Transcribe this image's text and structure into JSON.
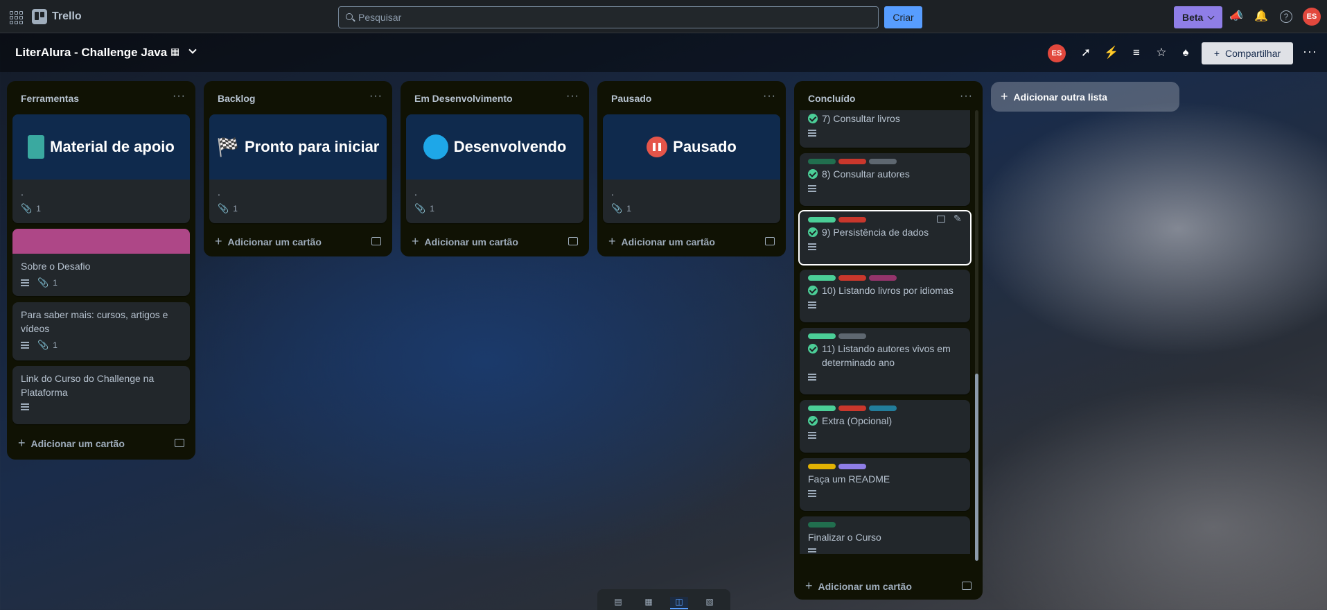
{
  "topbar": {
    "brand": "Trello",
    "search_placeholder": "Pesquisar",
    "create": "Criar",
    "beta": "Beta",
    "avatar": "ES"
  },
  "board": {
    "title": "LiterAlura - Challenge Java",
    "share": "Compartilhar",
    "avatar": "ES"
  },
  "colors": {
    "green": "#4bce97",
    "red": "#c9372c",
    "gray": "#5e6770",
    "darkgreen": "#216e4e",
    "yellow": "#e2b203",
    "purple": "#8f7ee7",
    "magenta": "#94346b",
    "blue": "#227d9b",
    "accent": "#579dff"
  },
  "lists": [
    {
      "title": "Ferramentas",
      "add": "Adicionar um cartão",
      "cards": [
        {
          "cover": "Material de apoio",
          "title": ".",
          "attachments": "1"
        },
        {
          "title": "Sobre o Desafio",
          "attachments": "1"
        },
        {
          "title": "Para saber mais: cursos, artigos e vídeos",
          "attachments": "1"
        },
        {
          "title": "Link do Curso do Challenge na Plataforma"
        }
      ]
    },
    {
      "title": "Backlog",
      "add": "Adicionar um cartão",
      "cards": [
        {
          "cover": "Pronto para iniciar",
          "title": ".",
          "attachments": "1"
        }
      ]
    },
    {
      "title": "Em Desenvolvimento",
      "add": "Adicionar um cartão",
      "cards": [
        {
          "cover": "Desenvolvendo",
          "title": ".",
          "attachments": "1"
        }
      ]
    },
    {
      "title": "Pausado",
      "add": "Adicionar um cartão",
      "cards": [
        {
          "cover": "Pausado",
          "title": ".",
          "attachments": "1"
        }
      ]
    },
    {
      "title": "Concluído",
      "add": "Adicionar um cartão",
      "cards": [
        {
          "title": "7) Consultar livros"
        },
        {
          "title": "8) Consultar autores"
        },
        {
          "title": "9) Persistência de dados"
        },
        {
          "title": "10) Listando livros por idiomas"
        },
        {
          "title": "11) Listando autores vivos em determinado ano"
        },
        {
          "title": "Extra (Opcional)"
        },
        {
          "title": "Faça um README"
        },
        {
          "title": "Finalizar o Curso"
        }
      ]
    }
  ],
  "add_list": "Adicionar outra lista"
}
